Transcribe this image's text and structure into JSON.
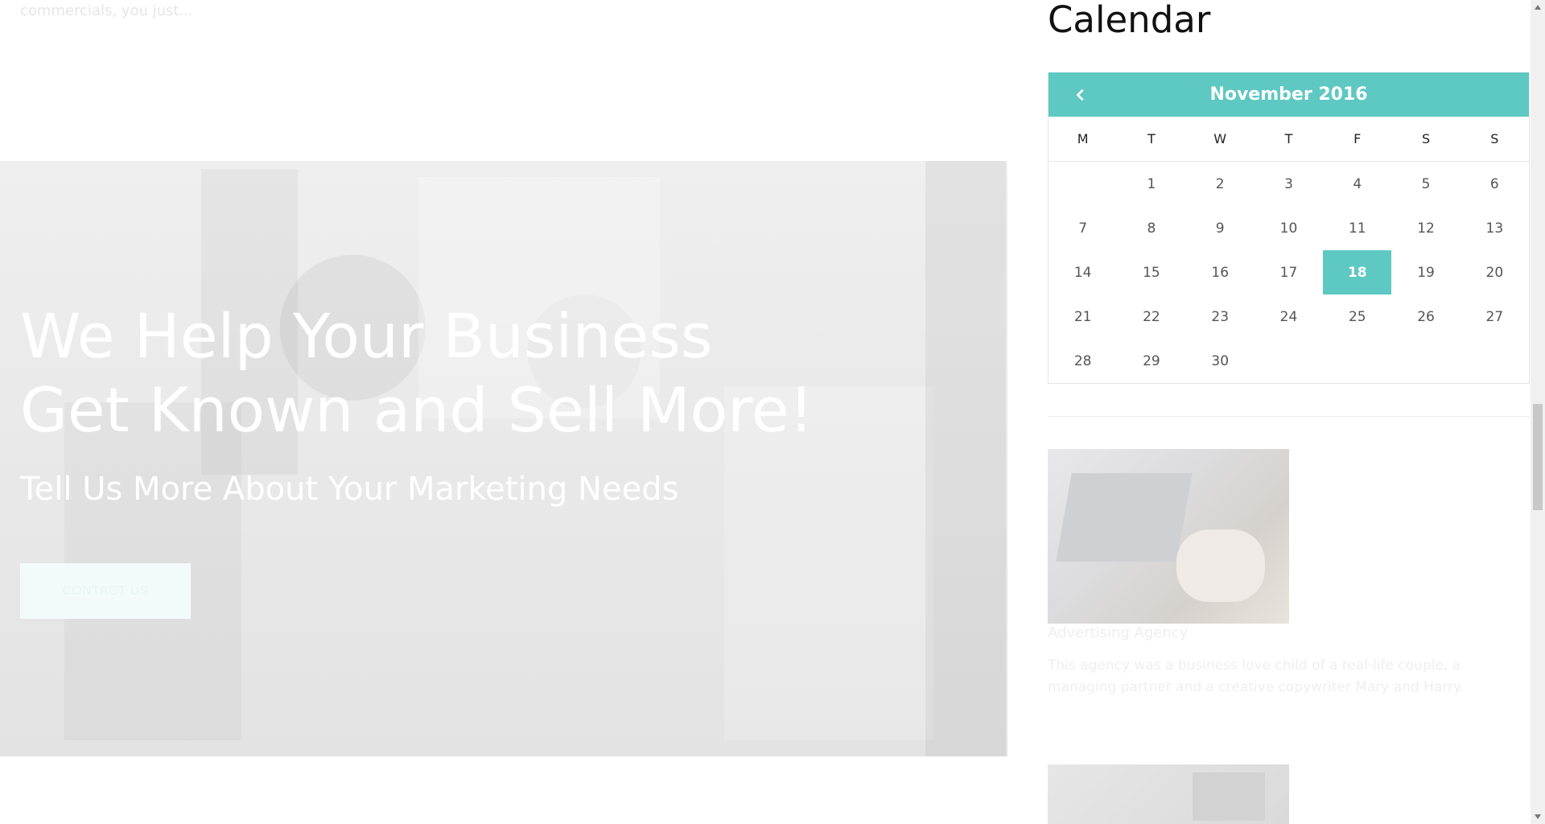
{
  "top_snippet": "commercials, you just...",
  "hero": {
    "title_line1": "We Help Your Business",
    "title_line2": "Get Known and Sell More!",
    "subtitle": "Tell Us More About Your Marketing Needs",
    "button_label": "CONTACT US"
  },
  "sidebar": {
    "calendar_heading": "Calendar",
    "calendar": {
      "month_label": "November 2016",
      "prev_icon": "chevron-left-icon",
      "weekdays": [
        "M",
        "T",
        "W",
        "T",
        "F",
        "S",
        "S"
      ],
      "days": [
        "",
        "1",
        "2",
        "3",
        "4",
        "5",
        "6",
        "7",
        "8",
        "9",
        "10",
        "11",
        "12",
        "13",
        "14",
        "15",
        "16",
        "17",
        "18",
        "19",
        "20",
        "21",
        "22",
        "23",
        "24",
        "25",
        "26",
        "27",
        "28",
        "29",
        "30",
        "",
        "",
        "",
        ""
      ],
      "today": "18",
      "accent_color": "#5ec8c2"
    },
    "post": {
      "title": "Advertising Agency",
      "excerpt": "This agency was a business love child of a real-life couple, a managing partner and a creative copywriter Mary and Harry."
    }
  }
}
